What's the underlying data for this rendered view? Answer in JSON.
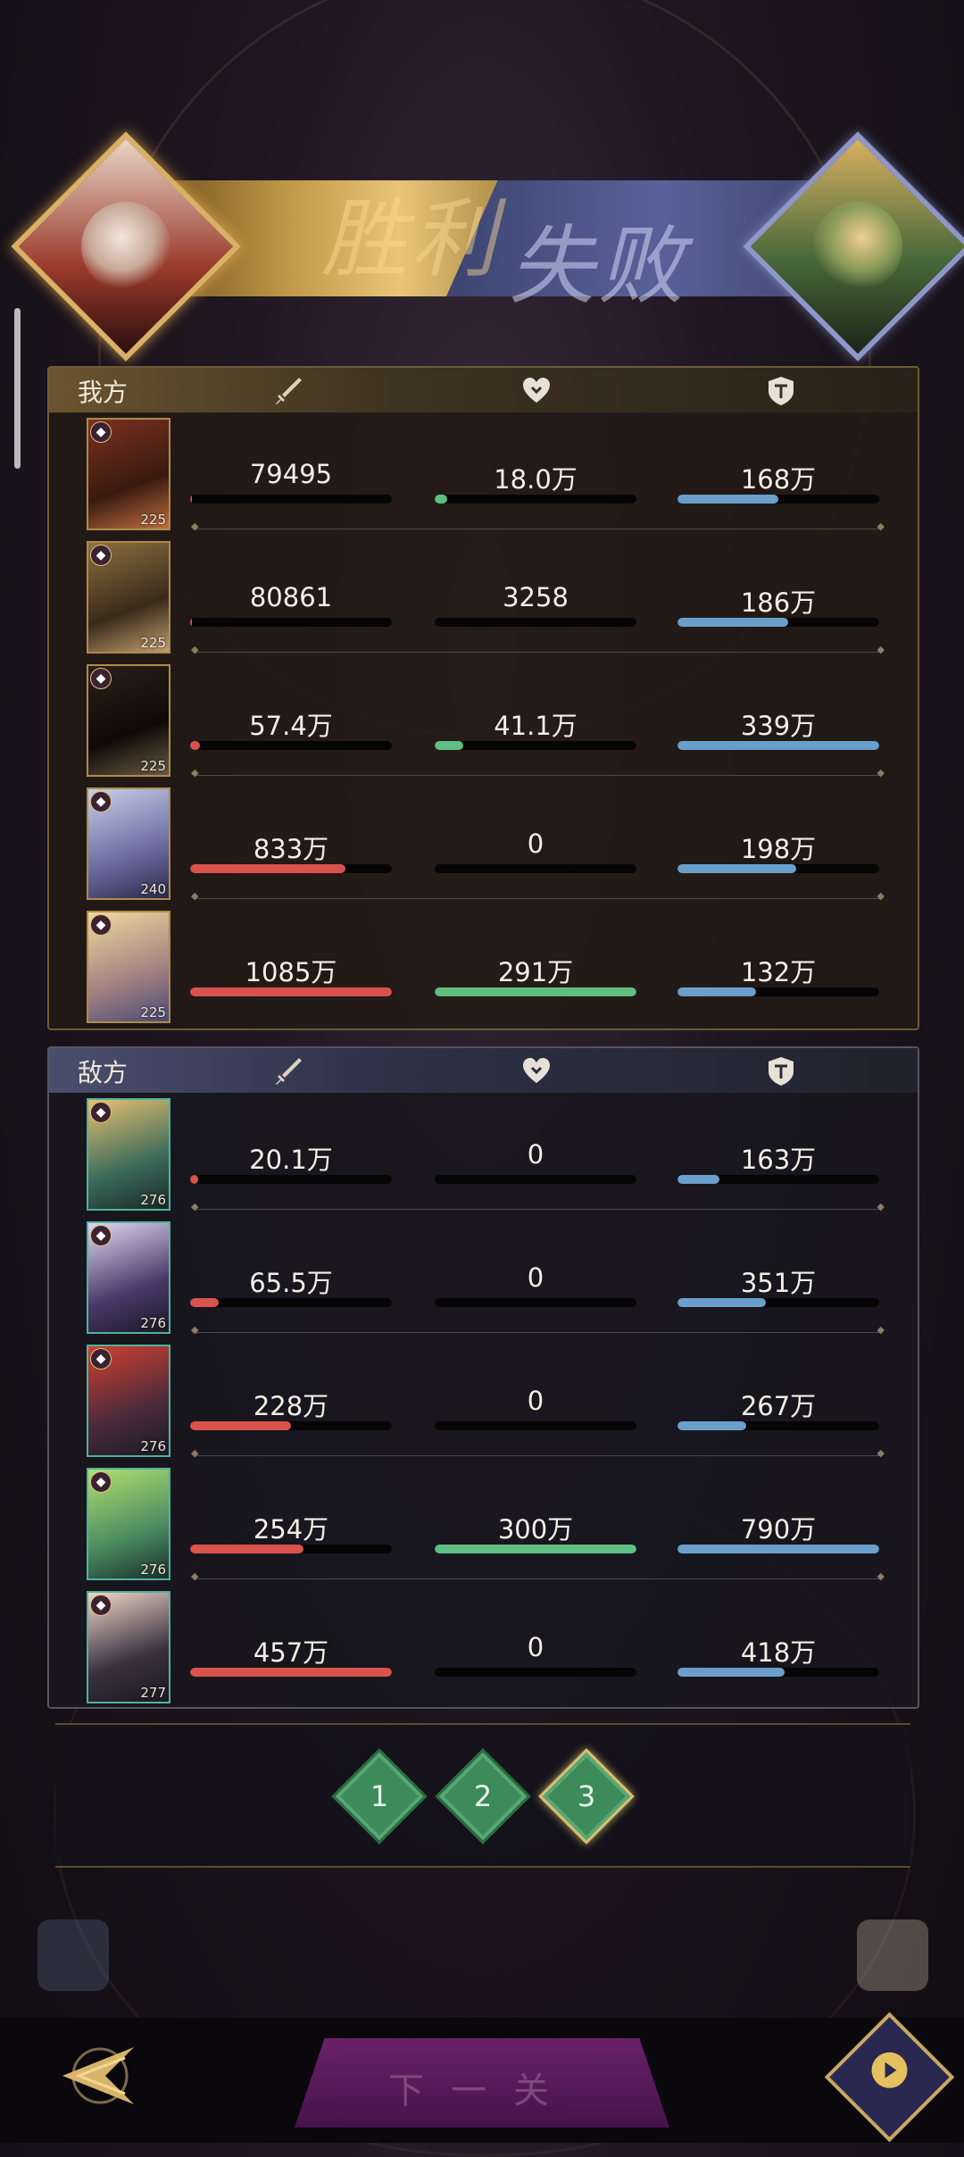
{
  "result": {
    "win_label": "胜利",
    "lose_label": "失败"
  },
  "columns": {
    "attack_icon": "sword-icon",
    "heal_icon": "heart-icon",
    "defense_icon": "shield-icon"
  },
  "colors": {
    "attack": "#d8534c",
    "heal": "#5fbf82",
    "defense": "#6a9fcb"
  },
  "my_team": {
    "label": "我方",
    "heroes": [
      {
        "level": "225",
        "attack": "79495",
        "heal": "18.0万",
        "defense": "168万",
        "attack_pct": 0.01,
        "heal_pct": 0.06,
        "defense_pct": 0.5
      },
      {
        "level": "225",
        "attack": "80861",
        "heal": "3258",
        "defense": "186万",
        "attack_pct": 0.01,
        "heal_pct": 0.0,
        "defense_pct": 0.55
      },
      {
        "level": "225",
        "attack": "57.4万",
        "heal": "41.1万",
        "defense": "339万",
        "attack_pct": 0.05,
        "heal_pct": 0.14,
        "defense_pct": 1.0
      },
      {
        "level": "240",
        "attack": "833万",
        "heal": "0",
        "defense": "198万",
        "attack_pct": 0.77,
        "heal_pct": 0.0,
        "defense_pct": 0.59
      },
      {
        "level": "225",
        "attack": "1085万",
        "heal": "291万",
        "defense": "132万",
        "attack_pct": 1.0,
        "heal_pct": 1.0,
        "defense_pct": 0.39
      }
    ]
  },
  "enemy_team": {
    "label": "敌方",
    "heroes": [
      {
        "level": "276",
        "attack": "20.1万",
        "heal": "0",
        "defense": "163万",
        "attack_pct": 0.04,
        "heal_pct": 0.0,
        "defense_pct": 0.21
      },
      {
        "level": "276",
        "attack": "65.5万",
        "heal": "0",
        "defense": "351万",
        "attack_pct": 0.14,
        "heal_pct": 0.0,
        "defense_pct": 0.44
      },
      {
        "level": "276",
        "attack": "228万",
        "heal": "0",
        "defense": "267万",
        "attack_pct": 0.5,
        "heal_pct": 0.0,
        "defense_pct": 0.34
      },
      {
        "level": "276",
        "attack": "254万",
        "heal": "300万",
        "defense": "790万",
        "attack_pct": 0.56,
        "heal_pct": 1.0,
        "defense_pct": 1.0
      },
      {
        "level": "277",
        "attack": "457万",
        "heal": "0",
        "defense": "418万",
        "attack_pct": 1.0,
        "heal_pct": 0.0,
        "defense_pct": 0.53
      }
    ]
  },
  "rounds": {
    "items": [
      "1",
      "2",
      "3"
    ],
    "selected": "3"
  },
  "bottom": {
    "next_label": "下一关"
  }
}
